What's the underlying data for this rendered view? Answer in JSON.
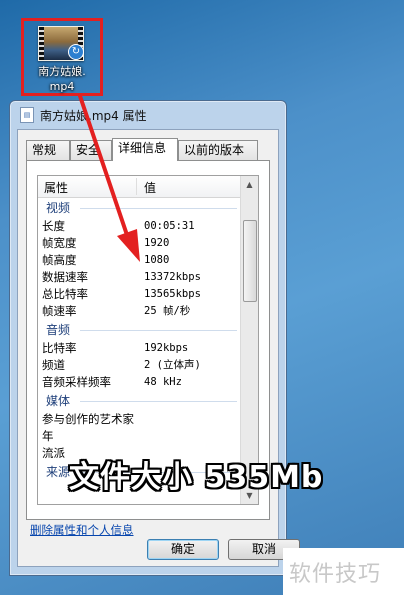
{
  "desktop_icon": {
    "label_line1": "南方姑娘.",
    "label_line2": "mp4"
  },
  "window": {
    "title": "南方姑娘.mp4 属性",
    "tabs": [
      "常规",
      "安全",
      "详细信息",
      "以前的版本"
    ],
    "columns": {
      "name": "属性",
      "value": "值"
    },
    "groups": [
      {
        "title": "视频",
        "rows": [
          {
            "k": "长度",
            "v": "00:05:31"
          },
          {
            "k": "帧宽度",
            "v": "1920"
          },
          {
            "k": "帧高度",
            "v": "1080"
          },
          {
            "k": "数据速率",
            "v": "13372kbps"
          },
          {
            "k": "总比特率",
            "v": "13565kbps"
          },
          {
            "k": "帧速率",
            "v": "25 帧/秒"
          }
        ]
      },
      {
        "title": "音频",
        "rows": [
          {
            "k": "比特率",
            "v": "192kbps"
          },
          {
            "k": "频道",
            "v": "2 (立体声)"
          },
          {
            "k": "音频采样频率",
            "v": "48 kHz"
          }
        ]
      },
      {
        "title": "媒体",
        "rows": [
          {
            "k": "参与创作的艺术家",
            "v": ""
          },
          {
            "k": "年",
            "v": ""
          },
          {
            "k": "流派",
            "v": ""
          }
        ]
      },
      {
        "title": "来源",
        "rows": []
      }
    ],
    "remove_link": "删除属性和个人信息",
    "ok_label": "确定",
    "cancel_label": "取消"
  },
  "overlay_caption": "文件大小 535Mb",
  "watermark": "软件技巧",
  "colors": {
    "highlight_box": "#e32020",
    "arrow": "#e32020",
    "group_heading": "#1e3f7a",
    "link": "#0645ad"
  }
}
